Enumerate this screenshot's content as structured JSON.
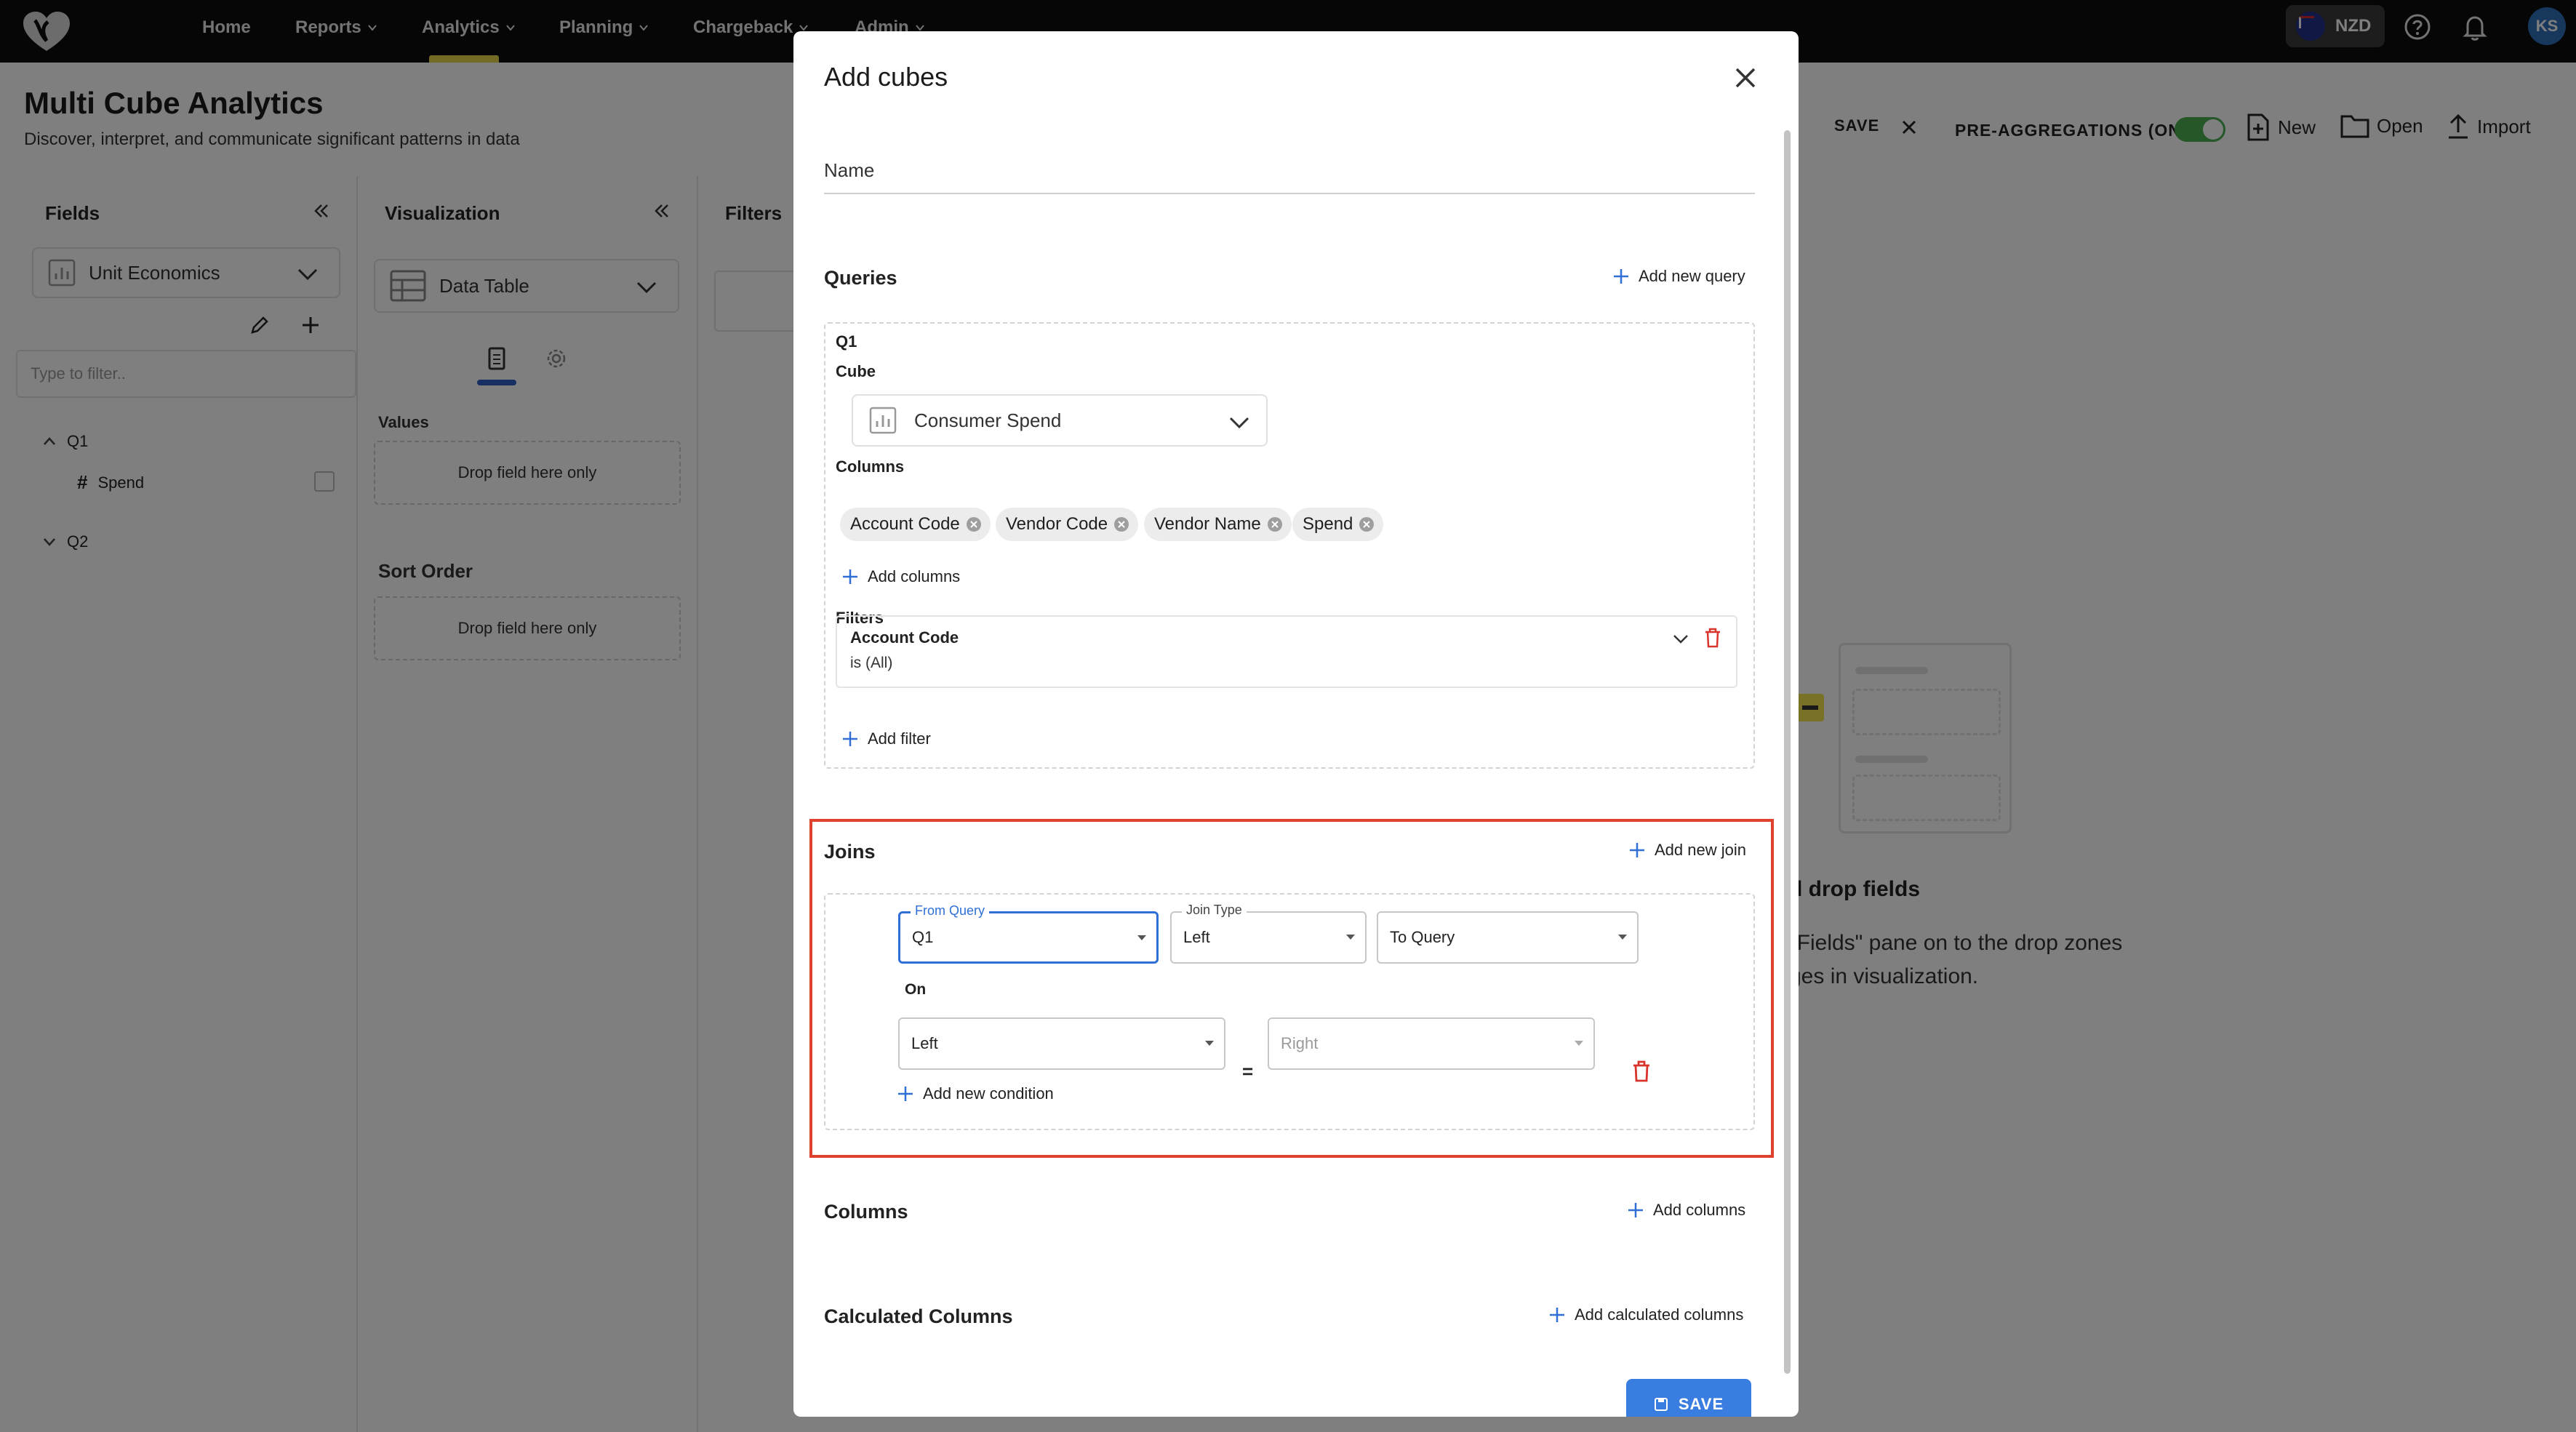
{
  "topnav": {
    "items": [
      {
        "label": "Home",
        "has_menu": false
      },
      {
        "label": "Reports",
        "has_menu": true
      },
      {
        "label": "Analytics",
        "has_menu": true
      },
      {
        "label": "Planning",
        "has_menu": true
      },
      {
        "label": "Chargeback",
        "has_menu": true
      },
      {
        "label": "Admin",
        "has_menu": true
      }
    ],
    "active_item": "Analytics",
    "currency": "NZD",
    "avatar_initials": "KS"
  },
  "page": {
    "title": "Multi Cube Analytics",
    "subtitle": "Discover, interpret, and communicate significant patterns in data",
    "toolbar": {
      "save_label": "SAVE",
      "preagg_label": "PRE-AGGREGATIONS (ON)",
      "preagg_on": true,
      "new_label": "New",
      "open_label": "Open",
      "import_label": "Import"
    },
    "fields_panel": {
      "title": "Fields",
      "selected_cube": "Unit Economics",
      "filter_placeholder": "Type to filter..",
      "tree": [
        {
          "label": "Q1",
          "expanded": true,
          "children": [
            {
              "label": "Spend",
              "type_icon": "hash-icon"
            }
          ]
        },
        {
          "label": "Q2",
          "expanded": false,
          "children": []
        }
      ]
    },
    "viz_panel": {
      "title": "Visualization",
      "selected_viz": "Data Table",
      "values_label": "Values",
      "values_drop": "Drop field here only",
      "sort_label": "Sort Order",
      "sort_drop": "Drop field here only"
    },
    "filters_panel": {
      "title": "Filters"
    },
    "empty_state": {
      "heading": "d drop fields",
      "line1": "\"Fields\" pane on to the drop zones",
      "line2": "ges in visualization."
    }
  },
  "modal": {
    "title": "Add cubes",
    "name_label": "Name",
    "queries": {
      "title": "Queries",
      "add_label": "Add new query",
      "items": [
        {
          "name": "Q1",
          "cube_label": "Cube",
          "cube_value": "Consumer Spend",
          "columns_label": "Columns",
          "columns": [
            "Account Code",
            "Vendor Code",
            "Vendor Name",
            "Spend"
          ],
          "add_columns_label": "Add columns",
          "filters_label": "Filters",
          "filters": [
            {
              "field": "Account Code",
              "condition": "is (All)"
            }
          ],
          "add_filter_label": "Add filter"
        }
      ]
    },
    "joins": {
      "title": "Joins",
      "add_label": "Add new join",
      "from_query_label": "From Query",
      "from_query_value": "Q1",
      "join_type_label": "Join Type",
      "join_type_value": "Left",
      "to_query_value": "To Query",
      "on_label": "On",
      "left_value": "Left",
      "equals": "=",
      "right_value": "Right",
      "add_condition_label": "Add new condition"
    },
    "columns": {
      "title": "Columns",
      "add_label": "Add columns"
    },
    "calculated": {
      "title": "Calculated Columns",
      "add_label": "Add calculated columns"
    },
    "save_label": "SAVE"
  },
  "colors": {
    "accent_blue": "#3a7de0",
    "highlight_red": "#e0402e",
    "delete_red": "#d9342b",
    "nav_bg": "#0c0c0c",
    "toggle_green": "#4caf50"
  }
}
